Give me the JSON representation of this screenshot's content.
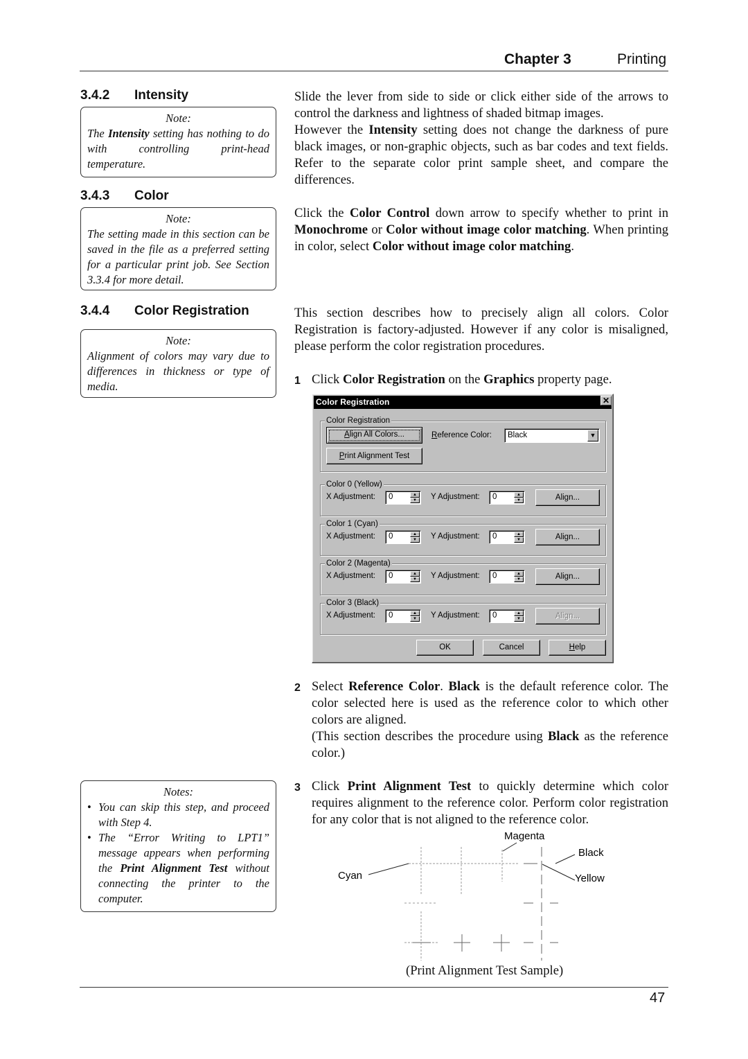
{
  "header": {
    "chapter": "Chapter 3",
    "title": "Printing"
  },
  "footer": {
    "page_number": "47"
  },
  "sections": {
    "intensity": {
      "number": "3.4.2",
      "title": "Intensity",
      "note_title": "Note:",
      "note_parts": [
        "The ",
        "Intensity",
        " setting has nothing to do with controlling print-head temperature."
      ]
    },
    "color": {
      "number": "3.4.3",
      "title": "Color",
      "note_title": "Note:",
      "note_text": "The setting made in this section can be saved in the file as a preferred setting for a particular print job. See Section 3.3.4 for more detail."
    },
    "color_registration": {
      "number": "3.4.4",
      "title": "Color Registration",
      "note_title": "Note:",
      "note_text": "Alignment of colors may vary due to differences in thickness or type of media."
    }
  },
  "body": {
    "intensity_para": {
      "p1": "Slide the lever from side to side or click either side of the arrows to control the darkness and lightness of shaded bitmap images.",
      "p2a": "However the ",
      "p2b": "Intensity",
      "p2c": " setting does not change the darkness of pure black images, or non-graphic objects, such as bar codes and text fields. Refer to the separate color print sample sheet, and compare the differences."
    },
    "color_para": {
      "a": "Click the ",
      "b": "Color Control",
      "c": " down arrow to specify whether to print in ",
      "d": "Monochrome",
      "e": " or ",
      "f": "Color without image color matching",
      "g": ".  When printing in color, select ",
      "h": "Color without image color matching",
      "i": "."
    },
    "registration_para": "This section describes how to precisely align all colors.  Color Registration is factory-adjusted. However if any color is misaligned, please perform the color registration procedures.",
    "steps": [
      {
        "num": "1",
        "a": "Click ",
        "b": "Color Registration",
        "c": " on the ",
        "d": "Graphics",
        "e": " property page."
      },
      {
        "num": "2",
        "a": "Select ",
        "b": "Reference Color",
        "c": ".  ",
        "d": "Black",
        "e": " is the default reference color. The color selected here is used as the reference color to which other colors are aligned.",
        "sub_a": "(This section describes the procedure using ",
        "sub_b": "Black",
        "sub_c": " as the reference color.)"
      },
      {
        "num": "3",
        "a": "Click ",
        "b": "Print Alignment Test",
        "c": " to quickly determine which color requires alignment to the reference color.  Perform color registration for any color that is not aligned to the reference color."
      }
    ]
  },
  "side_notes": {
    "title": "Notes:",
    "items": [
      {
        "a": "You can skip this step, and proceed with Step 4."
      },
      {
        "a": "The “Error Writing to LPT1” message appears when performing the ",
        "b": "Print Alignment Test",
        "c": " without connecting the printer to the computer."
      }
    ]
  },
  "dialog": {
    "title": "Color Registration",
    "close_icon": "close-x-icon",
    "group_main": "Color Registration",
    "align_all_button": {
      "u": "A",
      "rest": "lign All Colors..."
    },
    "print_test_button": {
      "u": "P",
      "rest": "rint Alignment Test"
    },
    "reference_label": {
      "u": "R",
      "rest": "eference Color:"
    },
    "reference_value": "Black",
    "x_label": "X Adjustment:",
    "y_label": "Y Adjustment:",
    "color_groups": [
      {
        "label": "Color 0 (Yellow)",
        "x": "0",
        "y": "0",
        "align": "Align...",
        "align_enabled": true
      },
      {
        "label": "Color 1 (Cyan)",
        "x": "0",
        "y": "0",
        "align": "Align...",
        "align_enabled": true
      },
      {
        "label": "Color 2 (Magenta)",
        "x": "0",
        "y": "0",
        "align": "Align...",
        "align_enabled": true
      },
      {
        "label": "Color 3 (Black)",
        "x": "0",
        "y": "0",
        "align": "Align...",
        "align_enabled": false
      }
    ],
    "ok": "OK",
    "cancel": "Cancel",
    "help": {
      "u": "H",
      "rest": "elp"
    },
    "colors": {
      "face": "#c0c0c0",
      "title_bar": "#000000",
      "disabled_text": "#808080"
    }
  },
  "sample": {
    "caption": "(Print Alignment Test Sample)",
    "labels": {
      "magenta": "Magenta",
      "black": "Black",
      "cyan": "Cyan",
      "yellow": "Yellow"
    }
  }
}
